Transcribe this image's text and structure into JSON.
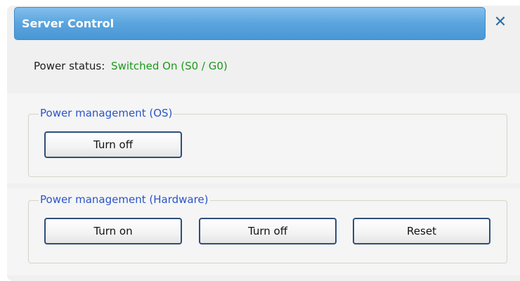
{
  "dialog": {
    "title": "Server Control",
    "close_label": "✕"
  },
  "status": {
    "label": "Power status:",
    "value": "Switched On (S0 / G0)",
    "value_color": "#1a9a1a"
  },
  "os_group": {
    "legend": "Power management (OS)",
    "buttons": {
      "turn_off": "Turn off"
    }
  },
  "hw_group": {
    "legend": "Power management (Hardware)",
    "buttons": {
      "turn_on": "Turn on",
      "turn_off": "Turn off",
      "reset": "Reset"
    }
  },
  "colors": {
    "title_bar": "#5aa4de",
    "legend_text": "#2b55c8",
    "button_border": "#2e4f7a"
  }
}
